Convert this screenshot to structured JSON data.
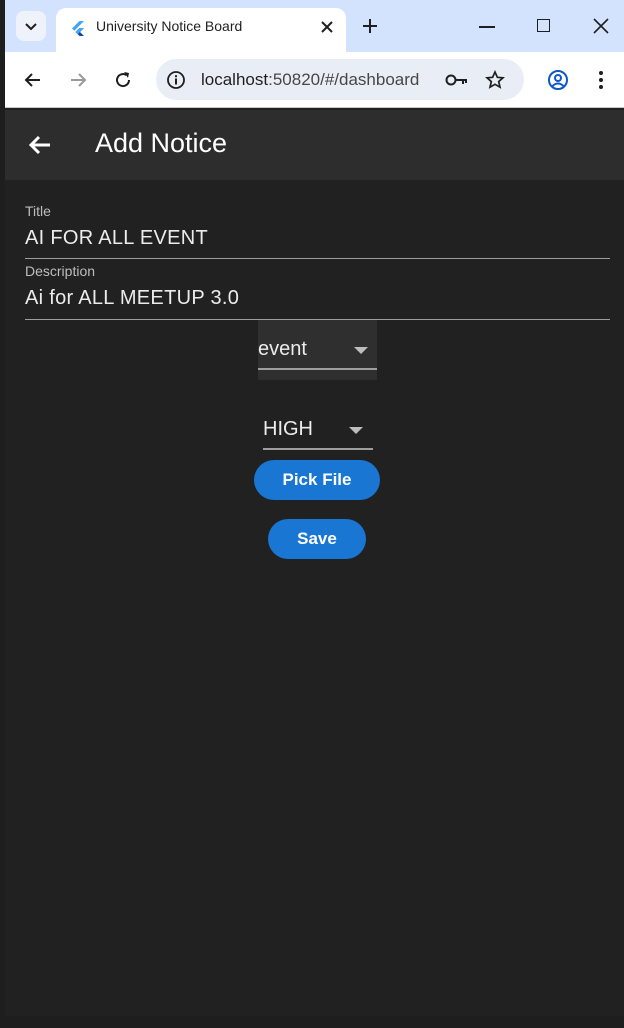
{
  "browser": {
    "tab_title": "University Notice Board",
    "url_host": "localhost",
    "url_rest": ":50820/#/dashboard"
  },
  "app": {
    "title": "Add Notice",
    "fields": {
      "title_label": "Title",
      "title_value": "AI FOR ALL EVENT",
      "description_label": "Description",
      "description_value": "Ai for ALL MEETUP 3.0"
    },
    "category_value": "event",
    "priority_value": "HIGH",
    "pick_file_label": "Pick File",
    "save_label": "Save"
  },
  "colors": {
    "accent": "#1976d2",
    "background": "#212121",
    "appbar": "#2d2d2d"
  },
  "icons": [
    "tab-search-icon",
    "flutter-icon",
    "close-icon",
    "new-tab-icon",
    "minimize-icon",
    "maximize-icon",
    "window-close-icon",
    "back-icon",
    "forward-icon",
    "reload-icon",
    "site-info-icon",
    "key-icon",
    "star-icon",
    "profile-icon",
    "menu-icon",
    "arrow-back-icon",
    "caret-down-icon"
  ]
}
